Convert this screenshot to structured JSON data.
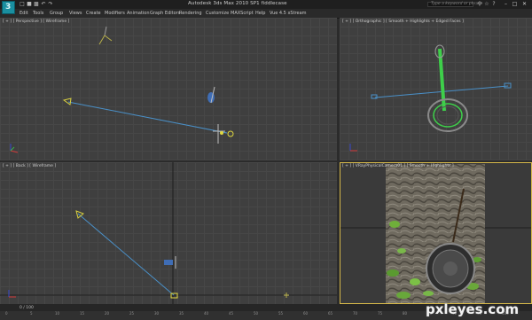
{
  "window": {
    "title": "Autodesk 3ds Max  2010 SP1      fiddlecase",
    "search_placeholder": "Type a keyword or phrase"
  },
  "menu": [
    "Edit",
    "Tools",
    "Group",
    "Views",
    "Create",
    "Modifiers",
    "Animation",
    "Graph Editors",
    "Rendering",
    "Customize",
    "MAXScript",
    "Help",
    "Vue 4.5 xStream"
  ],
  "viewports": {
    "top_left": {
      "label": "[ + ] [ Perspective ] [ Wireframe ]"
    },
    "top_right": {
      "label": "[ + ] [ Orthographic ] [ Smooth + Highlights + Edged Faces ]"
    },
    "bottom_left": {
      "label": "[ + ] [ Back ] [ Wireframe ]"
    },
    "bottom_right": {
      "label": "[ + ] [ VRayPhysicalCamera01 ] [ Smooth + Highlights ]"
    }
  },
  "timeline": {
    "frame_counter": "0 / 100",
    "ticks": [
      "0",
      "5",
      "10",
      "15",
      "20",
      "25",
      "30",
      "35",
      "40",
      "45",
      "50",
      "55",
      "60",
      "65",
      "70",
      "75",
      "80",
      "85",
      "90",
      "95",
      "100"
    ]
  },
  "watermark": "pxleyes.com",
  "colors": {
    "viewport_bg": "#3f3f3f",
    "active_border": "#d6b84a",
    "camera_line": "#4a90c8",
    "banjo_body": "#3ecf4a",
    "gizmo_yellow": "#e0d840"
  }
}
